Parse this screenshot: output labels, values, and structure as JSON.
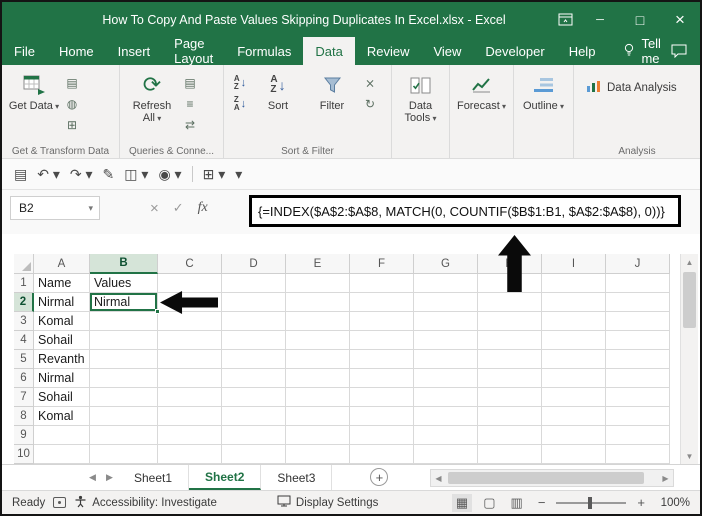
{
  "colors": {
    "excel_green": "#217346",
    "annotation_black": "#0a0a0a"
  },
  "titlebar": {
    "title": "How To Copy And Paste Values Skipping Duplicates In Excel.xlsx - Excel"
  },
  "menu": {
    "tabs": [
      "File",
      "Home",
      "Insert",
      "Page Layout",
      "Formulas",
      "Data",
      "Review",
      "View",
      "Developer",
      "Help"
    ],
    "active_tab": "Data",
    "tell_me": "Tell me"
  },
  "ribbon": {
    "get_data_label": "Get Data",
    "refresh_all_label": "Refresh All",
    "sort_label": "Sort",
    "filter_label": "Filter",
    "data_tools_label": "Data Tools",
    "forecast_label": "Forecast",
    "outline_label": "Outline",
    "data_analysis_label": "Data Analysis",
    "group_labels": {
      "get_transform": "Get & Transform Data",
      "queries": "Queries & Conne...",
      "sort_filter": "Sort & Filter",
      "analysis": "Analysis"
    }
  },
  "qat_icons": [
    {
      "name": "workbook-view-icon",
      "glyph": "▤"
    },
    {
      "name": "undo-button",
      "glyph": "↶",
      "caret": true
    },
    {
      "name": "redo-button",
      "glyph": "↷",
      "caret": true
    },
    {
      "name": "format-painter-icon",
      "glyph": "✎"
    },
    {
      "name": "diagram-icon",
      "glyph": "◫",
      "caret": true
    },
    {
      "name": "camera-icon",
      "glyph": "◉",
      "caret": true
    },
    {
      "name": "separator",
      "glyph": "|"
    },
    {
      "name": "table-icon",
      "glyph": "⊞",
      "caret": true
    },
    {
      "name": "customize-qat-button",
      "glyph": "▾"
    }
  ],
  "formula_bar": {
    "name_box": "B2",
    "fx_label": "fx",
    "formula": "{=INDEX($A$2:$A$8, MATCH(0, COUNTIF($B$1:B1, $A$2:$A$8), 0))}"
  },
  "grid": {
    "column_headers": [
      "A",
      "B",
      "C",
      "D",
      "E",
      "F",
      "G",
      "H",
      "I",
      "J"
    ],
    "row_headers": [
      "1",
      "2",
      "3",
      "4",
      "5",
      "6",
      "7",
      "8",
      "9",
      "10"
    ],
    "selected_cell": "B2",
    "selected_column": "B",
    "selected_row": "2",
    "rows": [
      [
        "Name",
        "Values",
        "",
        "",
        "",
        "",
        "",
        "",
        "",
        ""
      ],
      [
        "Nirmal",
        "Nirmal",
        "",
        "",
        "",
        "",
        "",
        "",
        "",
        ""
      ],
      [
        "Komal",
        "",
        "",
        "",
        "",
        "",
        "",
        "",
        "",
        ""
      ],
      [
        "Sohail",
        "",
        "",
        "",
        "",
        "",
        "",
        "",
        "",
        ""
      ],
      [
        "Revanth",
        "",
        "",
        "",
        "",
        "",
        "",
        "",
        "",
        ""
      ],
      [
        "Nirmal",
        "",
        "",
        "",
        "",
        "",
        "",
        "",
        "",
        ""
      ],
      [
        "Sohail",
        "",
        "",
        "",
        "",
        "",
        "",
        "",
        "",
        ""
      ],
      [
        "Komal",
        "",
        "",
        "",
        "",
        "",
        "",
        "",
        "",
        ""
      ],
      [
        "",
        "",
        "",
        "",
        "",
        "",
        "",
        "",
        "",
        ""
      ],
      [
        "",
        "",
        "",
        "",
        "",
        "",
        "",
        "",
        "",
        ""
      ]
    ]
  },
  "sheets": {
    "tabs": [
      "Sheet1",
      "Sheet2",
      "Sheet3"
    ],
    "active_tab": "Sheet2",
    "new_sheet_label": "+"
  },
  "status_bar": {
    "mode": "Ready",
    "accessibility": "Accessibility: Investigate",
    "display_settings": "Display Settings",
    "zoom_level": "100%"
  }
}
